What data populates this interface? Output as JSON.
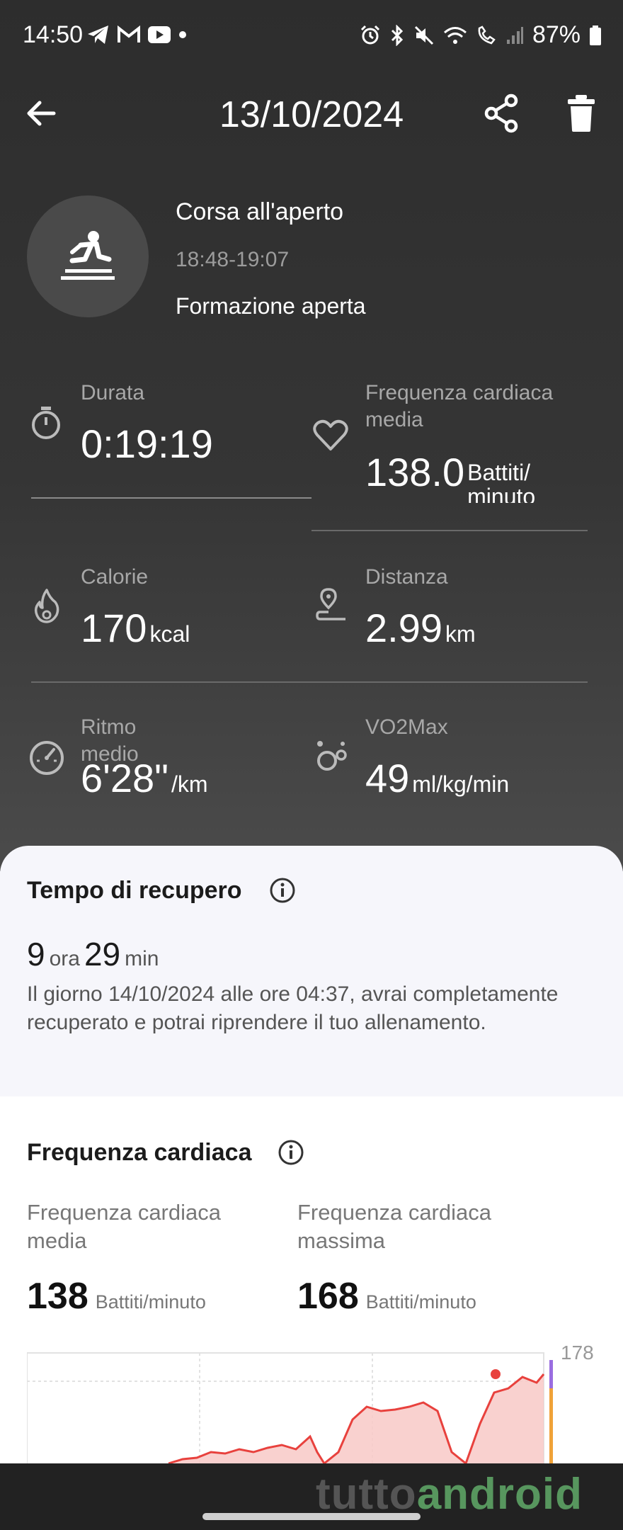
{
  "status_bar": {
    "time": "14:50",
    "battery": "87%",
    "left_icons": [
      "telegram-icon",
      "gmail-icon",
      "youtube-icon",
      "dot-icon"
    ],
    "right_icons": [
      "alarm-icon",
      "bluetooth-icon",
      "mute-icon",
      "wifi-icon",
      "wifi-call-icon",
      "signal-icon",
      "battery-icon"
    ]
  },
  "header": {
    "title": "13/10/2024",
    "icons": [
      "back-arrow-icon",
      "share-icon",
      "trash-icon"
    ]
  },
  "activity": {
    "icon": "running-person-icon",
    "name": "Corsa all'aperto",
    "time_range": "18:48-19:07",
    "mode": "Formazione aperta"
  },
  "stats": {
    "duration": {
      "label": "Durata",
      "value": "0:19:19",
      "unit": "",
      "icon": "stopwatch-icon"
    },
    "heart_rate": {
      "label": "Frequenza cardiaca media",
      "value": "138.0",
      "unit": "Battiti/ minuto",
      "icon": "heart-icon"
    },
    "calories": {
      "label": "Calorie",
      "value": "170",
      "unit": "kcal",
      "icon": "flame-icon"
    },
    "distance": {
      "label": "Distanza",
      "value": "2.99",
      "unit": "km",
      "icon": "location-route-icon"
    },
    "pace": {
      "label": "Ritmo medio",
      "value": "6'28\"",
      "unit": "/km",
      "icon": "speedometer-icon"
    },
    "vo2max": {
      "label": "VO2Max",
      "value": "49",
      "unit": "ml/kg/min",
      "icon": "bubbles-icon"
    }
  },
  "recovery": {
    "title": "Tempo di recupero",
    "hours": "9",
    "hours_unit": "ora",
    "minutes": "29",
    "minutes_unit": "min",
    "description": "Il giorno 14/10/2024 alle ore 04:37, avrai completamente recuperato e potrai riprendere il tuo allenamento."
  },
  "heart_rate_section": {
    "title": "Frequenza cardiaca",
    "avg_label": "Frequenza cardiaca media",
    "avg_value": "138",
    "avg_unit": "Battiti/minuto",
    "max_label": "Frequenza cardiaca massima",
    "max_value": "168",
    "max_unit": "Battiti/minuto",
    "chart_max_label": "178"
  },
  "watermark": {
    "part1": "tutto",
    "part2": "android"
  },
  "colors": {
    "dark_bg": "#2d2d2d",
    "sheet_bg": "#f6f6fb",
    "hr_red": "#e8413d",
    "hr_fill": "#f8c9c7"
  }
}
